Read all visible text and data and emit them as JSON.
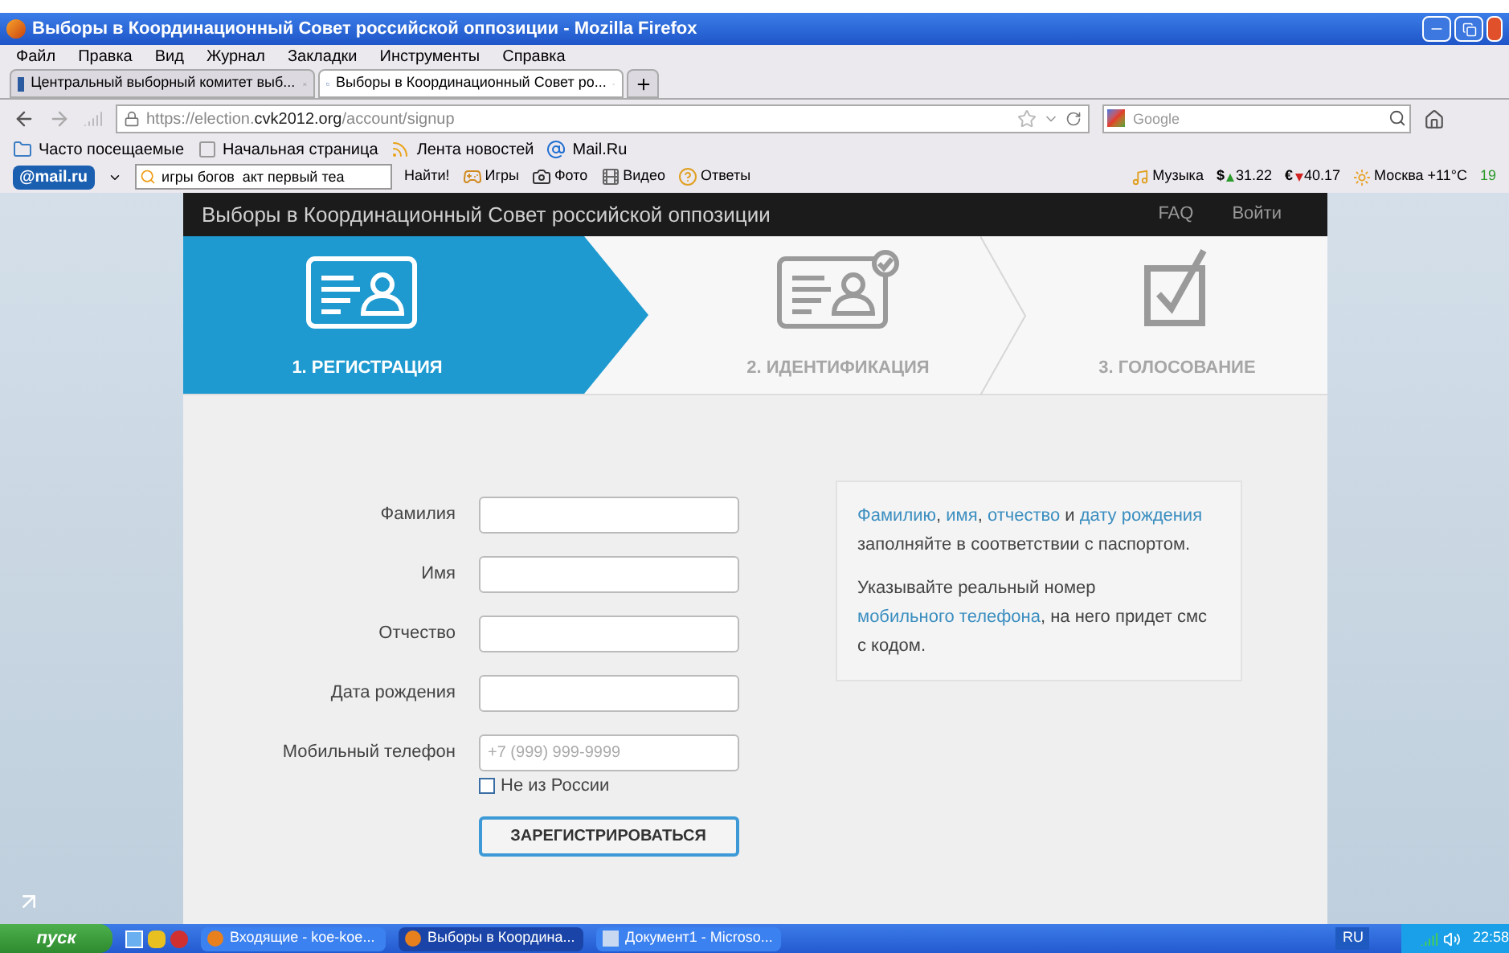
{
  "window": {
    "title": "Выборы в Координационный Совет российской оппозиции - Mozilla Firefox"
  },
  "menu": [
    "Файл",
    "Правка",
    "Вид",
    "Журнал",
    "Закладки",
    "Инструменты",
    "Справка"
  ],
  "tabs": [
    {
      "label": "Центральный выборный комитет выб...",
      "selected": false,
      "kind": "cvk"
    },
    {
      "label": "Выборы в Координационный Совет ро...",
      "selected": true,
      "kind": "check"
    }
  ],
  "address": {
    "url": [
      {
        "text": "https://election.",
        "strong": false
      },
      {
        "text": "cvk2012.org",
        "strong": true
      },
      {
        "text": "/account/signup",
        "strong": false
      }
    ]
  },
  "search": {
    "placeholder": "Google"
  },
  "bookmarks": [
    {
      "label": "Часто посещаемые",
      "kind": "folder"
    },
    {
      "label": "Начальная страница",
      "kind": "page"
    },
    {
      "label": "Лента новостей",
      "kind": "rss"
    },
    {
      "label": "Mail.Ru",
      "kind": "at"
    }
  ],
  "mail_toolbar": {
    "logo": "@mail.ru",
    "query": "игры богов  акт первый теа",
    "find": "Найти!",
    "items": [
      {
        "label": "Игры",
        "kind": "games"
      },
      {
        "label": "Фото",
        "kind": "photo"
      },
      {
        "label": "Видео",
        "kind": "video"
      },
      {
        "label": "Ответы",
        "kind": "answers"
      }
    ],
    "music": "Музыка",
    "rates": [
      {
        "symbol": "$",
        "value": "31.22",
        "rising": true
      },
      {
        "symbol": "€",
        "value": "40.17",
        "rising": false
      }
    ],
    "weather": "Москва +11°C",
    "traffic": "19"
  },
  "site": {
    "title": "Выборы в Координационный Совет российской оппозиции",
    "nav": [
      "FAQ",
      "Войти"
    ],
    "steps": [
      {
        "label": "1. РЕГИСТРАЦИЯ",
        "selected": true,
        "kind": "card"
      },
      {
        "label": "2. ИДЕНТИФИКАЦИЯ",
        "selected": false,
        "kind": "verified"
      },
      {
        "label": "3. ГОЛОСОВАНИЕ",
        "selected": false,
        "kind": "ballot"
      }
    ],
    "fields": [
      {
        "label": "Фамилия"
      },
      {
        "label": "Имя"
      },
      {
        "label": "Отчество"
      },
      {
        "label": "Дата рождения"
      },
      {
        "label": "Мобильный телефон",
        "placeholder": "+7 (999) 999-9999"
      }
    ],
    "abroad": {
      "label": "Не из России",
      "checked": false
    },
    "submit": "ЗАРЕГИСТРИРОВАТЬСЯ",
    "info": [
      [
        {
          "text": "Фамилию",
          "link": true
        },
        {
          "text": ", ",
          "link": false
        },
        {
          "text": "имя",
          "link": true
        },
        {
          "text": ", ",
          "link": false
        },
        {
          "text": "отчество",
          "link": true
        },
        {
          "text": " и ",
          "link": false
        },
        {
          "text": "дату рождения",
          "link": true
        },
        {
          "text": " заполняйте в соответствии с паспортом.",
          "link": false
        }
      ],
      [
        {
          "text": "Указывайте реальный номер ",
          "link": false
        },
        {
          "text": "мобильного телефона",
          "link": true
        },
        {
          "text": ", на него придет смс с кодом.",
          "link": false
        }
      ]
    ]
  },
  "taskbar": {
    "start": "пуск",
    "tasks": [
      {
        "label": "Входящие - koe-koe...",
        "selected": false,
        "kind": "firefox"
      },
      {
        "label": "Выборы в Координа...",
        "selected": true,
        "kind": "firefox"
      },
      {
        "label": "Документ1 - Microso...",
        "selected": false,
        "kind": "word"
      }
    ],
    "language": "RU",
    "clock": "22:58"
  }
}
